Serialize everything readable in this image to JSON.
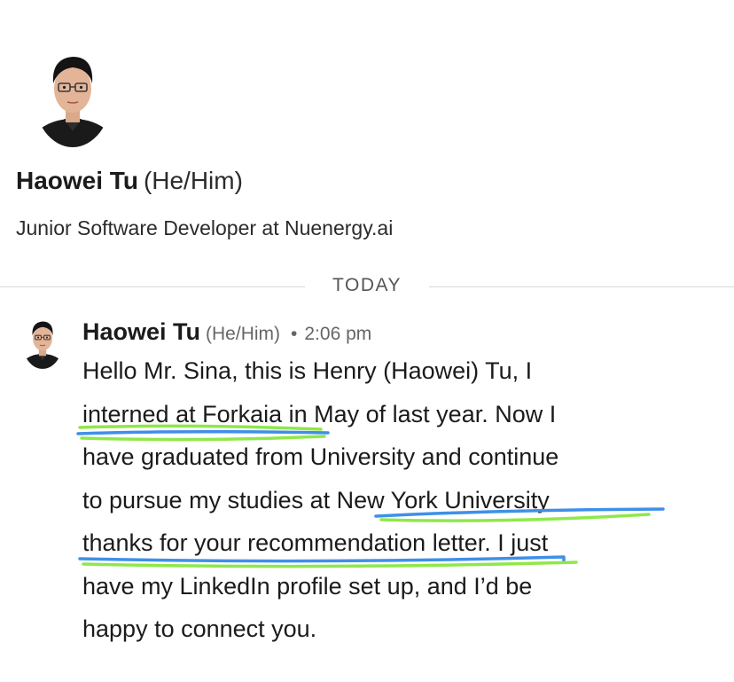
{
  "profile": {
    "name": "Haowei Tu",
    "pronouns": "(He/Him)",
    "headline": "Junior Software Developer at Nuenergy.ai"
  },
  "divider": {
    "label": "TODAY"
  },
  "message": {
    "sender_name": "Haowei Tu",
    "sender_pronouns": "(He/Him)",
    "separator": "•",
    "time": "2:06 pm",
    "lines": [
      "Hello Mr. Sina, this is Henry (Haowei) Tu, I",
      "interned at Forkaia in May of last year. Now I",
      "have graduated from University and continue",
      "to pursue my studies at New York University",
      "thanks for your recommendation letter.  I just",
      "have my LinkedIn profile set up, and I’d be",
      "happy to connect you."
    ]
  },
  "icons": {
    "profile_avatar": "user-photo-icon",
    "message_avatar": "user-photo-icon"
  },
  "colors": {
    "highlight_blue": "#3f8fe8",
    "highlight_green": "#8fe84a",
    "divider": "#d7d7d7",
    "meta_text": "#666666"
  }
}
